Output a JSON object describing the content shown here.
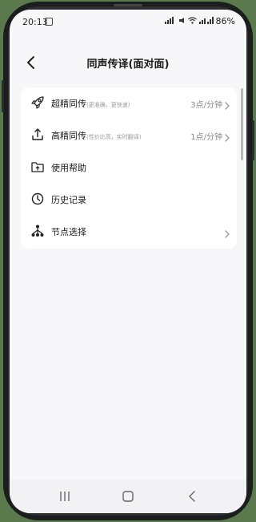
{
  "status": {
    "time": "20:13",
    "battery": "86%"
  },
  "header": {
    "title": "同声传译(面对面)"
  },
  "menu": {
    "items": [
      {
        "label": "超精同传",
        "sub": "(更准确，更快速)",
        "value": "3点/分钟",
        "icon": "rocket-icon",
        "chevron": true
      },
      {
        "label": "高精同传",
        "sub": "(性价比高，实时翻译)",
        "value": "1点/分钟",
        "icon": "upload-icon",
        "chevron": true
      },
      {
        "label": "使用帮助",
        "sub": "",
        "value": "",
        "icon": "folder-help-icon",
        "chevron": false
      },
      {
        "label": "历史记录",
        "sub": "",
        "value": "",
        "icon": "clock-icon",
        "chevron": false
      },
      {
        "label": "节点选择",
        "sub": "",
        "value": "",
        "icon": "node-tree-icon",
        "chevron": true
      }
    ]
  },
  "colors": {
    "screen_bg": "#f7f7f9",
    "card_bg": "#ffffff",
    "text": "#1a1a1a",
    "muted": "#9a9a9a"
  }
}
